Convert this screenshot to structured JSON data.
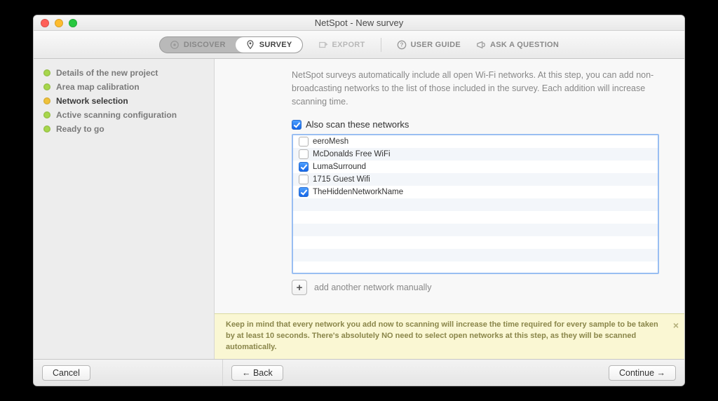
{
  "window": {
    "title": "NetSpot - New survey"
  },
  "toolbar": {
    "discover_label": "DISCOVER",
    "survey_label": "SURVEY",
    "export_label": "EXPORT",
    "userguide_label": "USER GUIDE",
    "ask_label": "ASK A QUESTION"
  },
  "sidebar": {
    "items": [
      {
        "label": "Details of the new project",
        "color": "#a7d74c",
        "current": false
      },
      {
        "label": "Area map calibration",
        "color": "#a7d74c",
        "current": false
      },
      {
        "label": "Network selection",
        "color": "#f0c23a",
        "current": true
      },
      {
        "label": "Active scanning configuration",
        "color": "#a7d74c",
        "current": false
      },
      {
        "label": "Ready to go",
        "color": "#a7d74c",
        "current": false
      }
    ]
  },
  "main": {
    "description": "NetSpot surveys automatically include all open Wi-Fi networks. At this step, you can add non-broadcasting networks to the list of those included in the survey. Each addition will increase scanning time.",
    "also_label": "Also scan these networks",
    "also_checked": true,
    "networks": [
      {
        "name": "eeroMesh",
        "checked": false
      },
      {
        "name": "McDonalds Free WiFi",
        "checked": false
      },
      {
        "name": "LumaSurround",
        "checked": true
      },
      {
        "name": "1715 Guest Wifi",
        "checked": false
      },
      {
        "name": "TheHiddenNetworkName",
        "checked": true
      }
    ],
    "list_visible_rows": 11,
    "add_label": "add another network manually"
  },
  "banner": {
    "text": "Keep in mind that every network you add now to scanning will increase the time required for every sample to be taken by at least 10 seconds. There's absolutely NO need to select open networks at this step, as they will be scanned automatically."
  },
  "footer": {
    "cancel": "Cancel",
    "back": "← Back",
    "continue": "Continue →"
  }
}
